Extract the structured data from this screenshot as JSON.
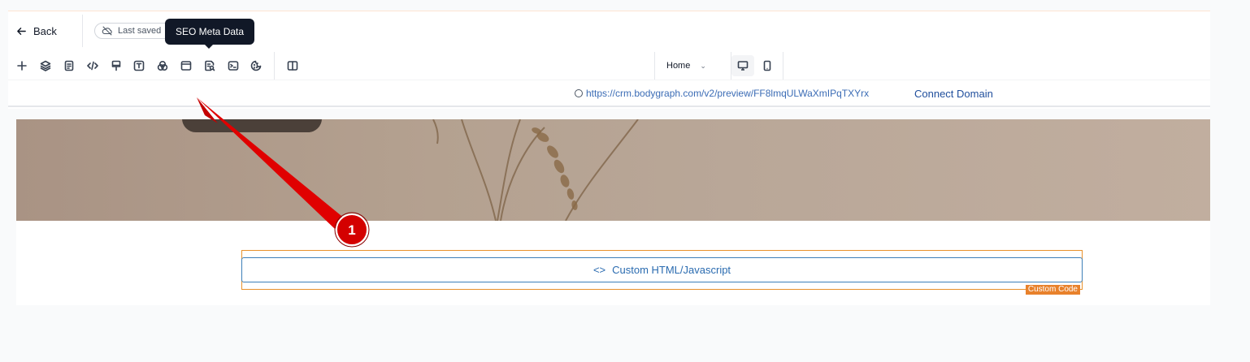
{
  "topbar": {
    "back_label": "Back",
    "saved_label": "Last saved",
    "tooltip": "SEO Meta Data"
  },
  "toolbar": {
    "tools": [
      "plus-icon",
      "layers-icon",
      "page-icon",
      "code-icon",
      "paint-brush-icon",
      "text-icon",
      "color-circles-icon",
      "browser-window-icon",
      "seo-search-icon",
      "terminal-icon",
      "cookie-icon",
      "split-view-icon"
    ],
    "page_select": "Home",
    "devices": [
      "desktop-icon",
      "mobile-icon"
    ]
  },
  "urlbar": {
    "url": "https://crm.bodygraph.com/v2/preview/FF8lmqULWaXmIPqTXYrx",
    "connect_label": "Connect Domain"
  },
  "canvas": {
    "code_block_label": "Custom HTML/Javascript",
    "code_tag": "Custom Code"
  },
  "annotation": {
    "badge": "1"
  },
  "colors": {
    "accent_blue": "#2a6bb0",
    "code_orange": "#e8812b",
    "tooltip_bg": "#111827",
    "badge_red": "#e00000"
  }
}
